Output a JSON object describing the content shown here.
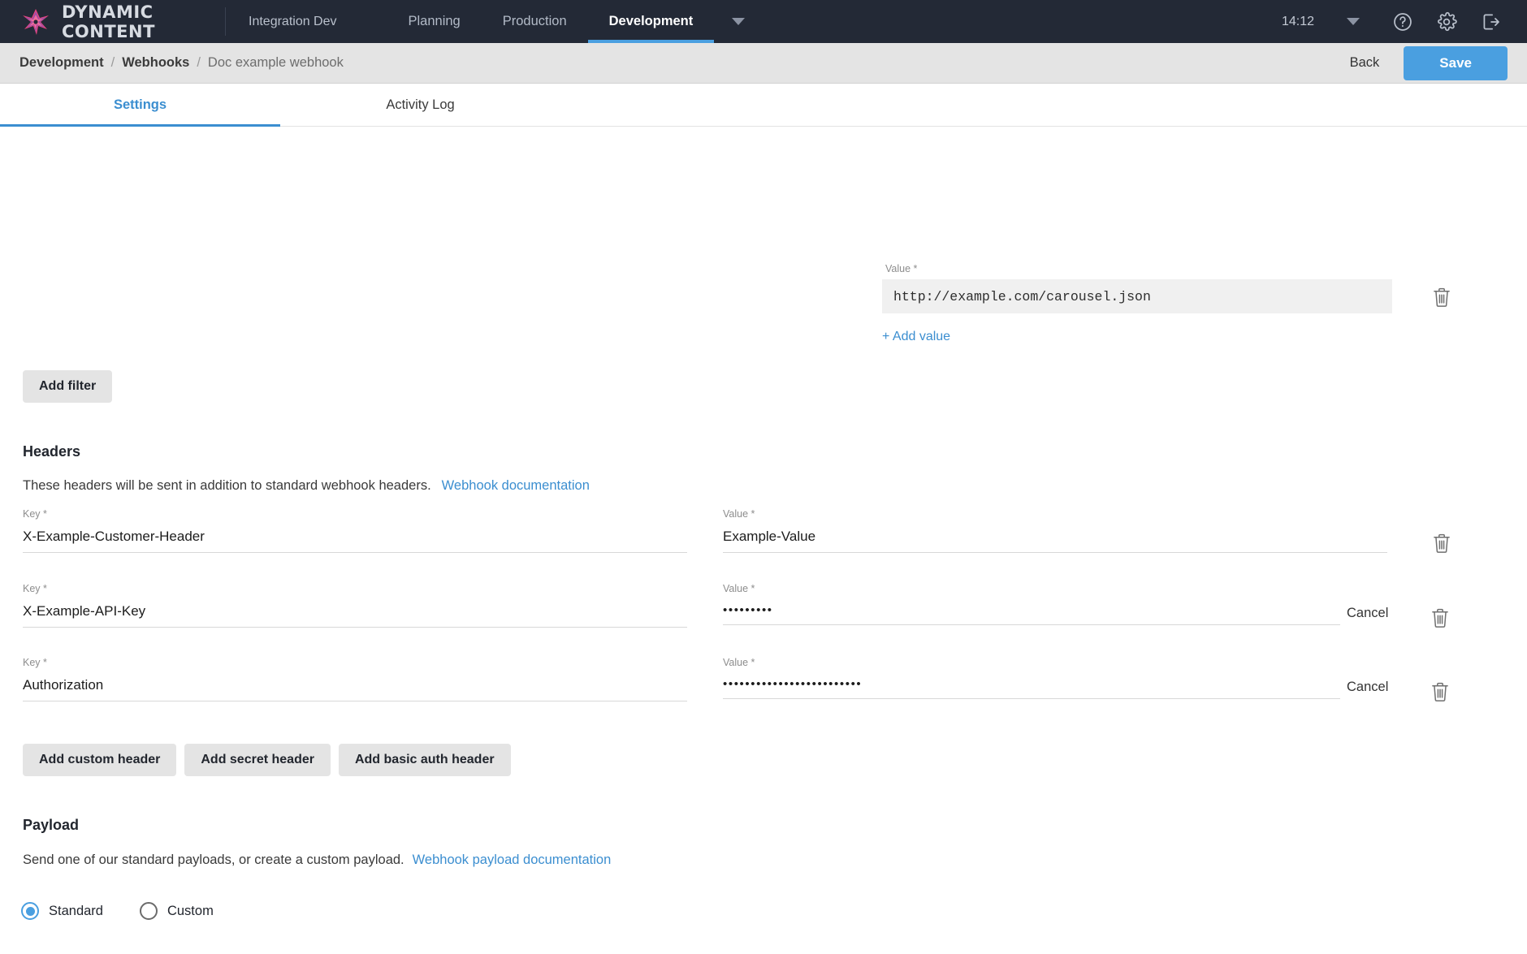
{
  "topnav": {
    "brand": "DYNAMIC CONTENT",
    "logo_icon": "dynamic-content-logo",
    "project": "Integration Dev",
    "tabs": [
      {
        "label": "Planning",
        "active": false
      },
      {
        "label": "Production",
        "active": false
      },
      {
        "label": "Development",
        "active": true
      }
    ],
    "dropdown_icon": "chevron-down-icon",
    "clock": "14:12",
    "clock_caret_icon": "chevron-down-icon",
    "help_icon": "help-circle-icon",
    "settings_icon": "gear-icon",
    "logout_icon": "logout-icon"
  },
  "breadcrumb": {
    "items": [
      "Development",
      "Webhooks",
      "Doc example webhook"
    ],
    "separator": "/"
  },
  "actions": {
    "back_label": "Back",
    "save_label": "Save"
  },
  "tabs": [
    {
      "label": "Settings",
      "active": true
    },
    {
      "label": "Activity Log",
      "active": false
    }
  ],
  "filters": {
    "value_label": "Value *",
    "value": "http://example.com/carousel.json",
    "add_value_label": "+ Add value",
    "delete_icon": "trash-icon",
    "add_filter_label": "Add filter"
  },
  "headers": {
    "title": "Headers",
    "description": "These headers will be sent in addition to standard webhook headers.",
    "doc_link": "Webhook documentation",
    "key_label": "Key *",
    "value_label": "Value *",
    "cancel_label": "Cancel",
    "delete_icon": "trash-icon",
    "rows": [
      {
        "key": "X-Example-Customer-Header",
        "value": "Example-Value",
        "secret": false,
        "cancel": false
      },
      {
        "key": "X-Example-API-Key",
        "value": "•••••••••",
        "secret": true,
        "cancel": true
      },
      {
        "key": "Authorization",
        "value": "•••••••••••••••••••••••••",
        "secret": true,
        "cancel": true
      }
    ],
    "buttons": [
      "Add custom header",
      "Add secret header",
      "Add basic auth header"
    ]
  },
  "payload": {
    "title": "Payload",
    "description": "Send one of our standard payloads, or create a custom payload.",
    "doc_link": "Webhook payload documentation",
    "options": [
      {
        "label": "Standard",
        "selected": true
      },
      {
        "label": "Custom",
        "selected": false
      }
    ]
  },
  "colors": {
    "navbar": "#232936",
    "accent": "#4a9fe0",
    "link": "#3b8ed0",
    "crumbbar": "#e4e4e4"
  }
}
